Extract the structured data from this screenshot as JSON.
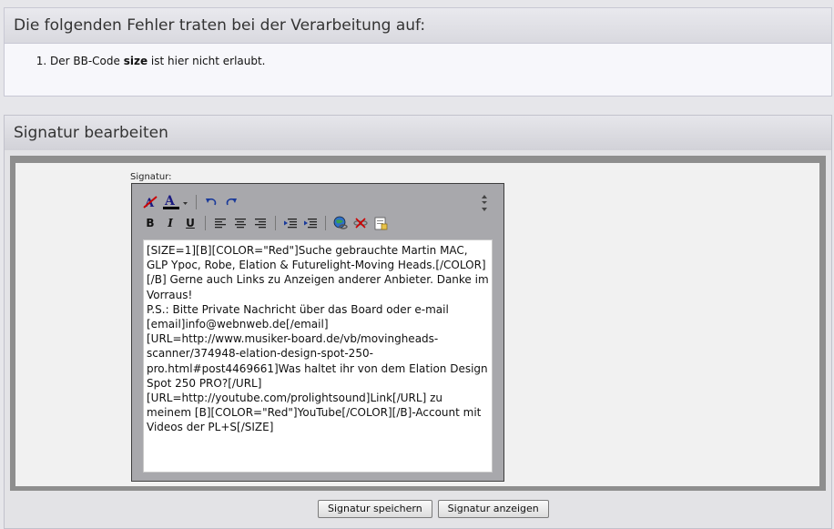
{
  "errors": {
    "title": "Die folgenden Fehler traten bei der Verarbeitung auf:",
    "items": [
      {
        "prefix": "Der BB-Code ",
        "code": "size",
        "suffix": " ist hier nicht erlaubt."
      }
    ]
  },
  "signature": {
    "title": "Signatur bearbeiten",
    "label": "Signatur:",
    "text": "[SIZE=1][B][COLOR=\"Red\"]Suche gebrauchte Martin MAC, GLP Ypoc, Robe, Elation & Futurelight-Moving Heads.[/COLOR][/B] Gerne auch Links zu Anzeigen anderer Anbieter. Danke im Vorraus!\nP.S.: Bitte Private Nachricht über das Board oder e-mail [email]info@webnweb.de[/email]\n[URL=http://www.musiker-board.de/vb/movingheads-scanner/374948-elation-design-spot-250-pro.html#post4469661]Was haltet ihr von dem Elation Design Spot 250 PRO?[/URL]\n[URL=http://youtube.com/prolightsound]Link[/URL] zu meinem [B][COLOR=\"Red\"]YouTube[/COLOR][/B]-Account mit Videos der PL+S[/SIZE]",
    "buttons": {
      "save": "Signatur speichern",
      "preview": "Signatur anzeigen"
    }
  },
  "toolbar": {
    "color_letter": "A",
    "bold": "B",
    "italic": "I",
    "underline": "U",
    "resize_symbol": "⇕",
    "color_accent": "#1a1a80"
  }
}
